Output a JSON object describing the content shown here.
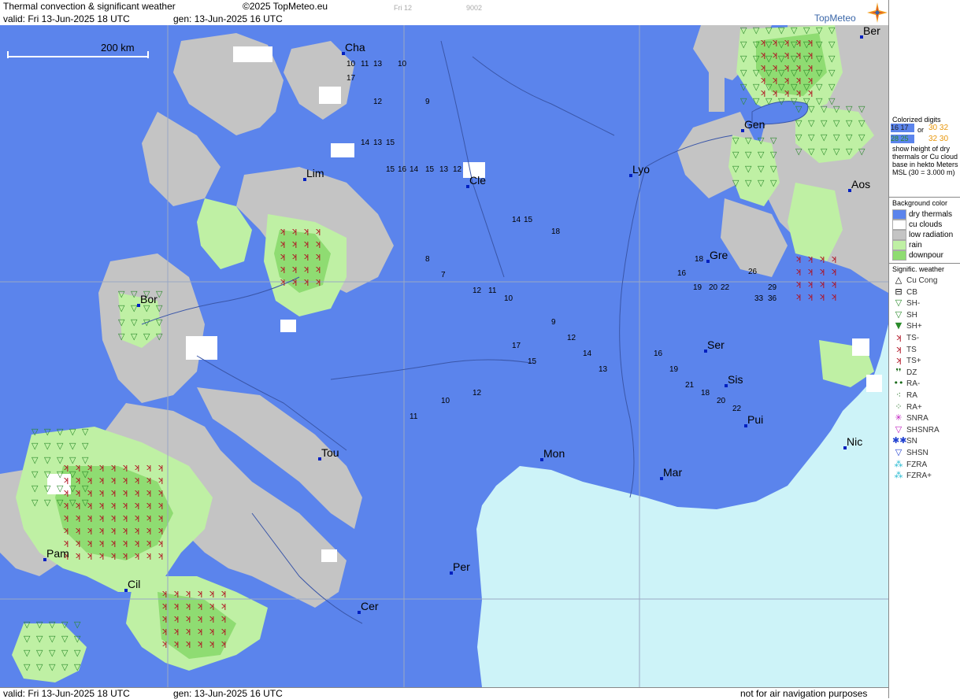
{
  "header": {
    "title": "Thermal convection & significant weather",
    "copyright": "©2025 TopMeteo.eu",
    "valid": "valid:  Fri  13-Jun-2025  18 UTC",
    "generated": "gen: 13-Jun-2025 16 UTC",
    "faint_day": "Fri 12",
    "faint_code": "9002",
    "logo": "TopMeteo"
  },
  "footer": {
    "valid": "valid:  Fri  13-Jun-2025  18 UTC",
    "generated": "gen: 13-Jun-2025 16 UTC",
    "disclaimer": "not for air navigation purposes"
  },
  "map": {
    "scale_label": "200 km",
    "colors": {
      "dry_thermals": "#5b84ec",
      "cu_clouds": "#ffffff",
      "low_radiation": "#c4c4c4",
      "rain": "#bff0a4",
      "downpour": "#8fdc72",
      "sea": "#cdf3f8",
      "grid": "#9aa8c4",
      "river": "#3a56a8",
      "ts_symbol": "#b01020",
      "sh_symbol": "#2a8a2a"
    },
    "cities": [
      {
        "id": "ber",
        "label": "Ber"
      },
      {
        "id": "cha",
        "label": "Cha"
      },
      {
        "id": "gen",
        "label": "Gen"
      },
      {
        "id": "lyo",
        "label": "Lyo"
      },
      {
        "id": "lim",
        "label": "Lim"
      },
      {
        "id": "cle",
        "label": "Cle"
      },
      {
        "id": "aos",
        "label": "Aos"
      },
      {
        "id": "gre",
        "label": "Gre"
      },
      {
        "id": "bor",
        "label": "Bor"
      },
      {
        "id": "ser",
        "label": "Ser"
      },
      {
        "id": "sis",
        "label": "Sis"
      },
      {
        "id": "pui",
        "label": "Pui"
      },
      {
        "id": "tou",
        "label": "Tou"
      },
      {
        "id": "mon",
        "label": "Mon"
      },
      {
        "id": "nic",
        "label": "Nic"
      },
      {
        "id": "mar",
        "label": "Mar"
      },
      {
        "id": "pam",
        "label": "Pam"
      },
      {
        "id": "cil",
        "label": "Cil"
      },
      {
        "id": "per",
        "label": "Per"
      },
      {
        "id": "cer",
        "label": "Cer"
      }
    ],
    "thermal_digits": [
      {
        "id": "d1",
        "v": "10"
      },
      {
        "id": "d2",
        "v": "11"
      },
      {
        "id": "d3",
        "v": "13"
      },
      {
        "id": "d4",
        "v": "10"
      },
      {
        "id": "d5",
        "v": "12"
      },
      {
        "id": "d6",
        "v": "14"
      },
      {
        "id": "d7",
        "v": "13"
      },
      {
        "id": "d8",
        "v": "15"
      },
      {
        "id": "d9",
        "v": "17"
      },
      {
        "id": "d10",
        "v": "15"
      },
      {
        "id": "d11",
        "v": "16"
      },
      {
        "id": "d12",
        "v": "14"
      },
      {
        "id": "d13",
        "v": "15"
      },
      {
        "id": "d14",
        "v": "13"
      },
      {
        "id": "d15",
        "v": "12"
      },
      {
        "id": "d16",
        "v": "9"
      },
      {
        "id": "d17",
        "v": "14"
      },
      {
        "id": "d18",
        "v": "15"
      },
      {
        "id": "d19",
        "v": "18"
      },
      {
        "id": "d20",
        "v": "18"
      },
      {
        "id": "d21",
        "v": "16"
      },
      {
        "id": "d22",
        "v": "19"
      },
      {
        "id": "d23",
        "v": "20"
      },
      {
        "id": "d24",
        "v": "22"
      },
      {
        "id": "d25",
        "v": "26"
      },
      {
        "id": "d26",
        "v": "29"
      },
      {
        "id": "d27",
        "v": "33"
      },
      {
        "id": "d28",
        "v": "36"
      },
      {
        "id": "d29",
        "v": "12"
      },
      {
        "id": "d30",
        "v": "11"
      },
      {
        "id": "d31",
        "v": "10"
      },
      {
        "id": "d32",
        "v": "8"
      },
      {
        "id": "d33",
        "v": "7"
      },
      {
        "id": "d34",
        "v": "9"
      },
      {
        "id": "d35",
        "v": "12"
      },
      {
        "id": "d36",
        "v": "14"
      },
      {
        "id": "d37",
        "v": "13"
      },
      {
        "id": "d38",
        "v": "16"
      },
      {
        "id": "d39",
        "v": "19"
      },
      {
        "id": "d40",
        "v": "21"
      },
      {
        "id": "d41",
        "v": "18"
      },
      {
        "id": "d42",
        "v": "20"
      },
      {
        "id": "d43",
        "v": "22"
      },
      {
        "id": "d44",
        "v": "17"
      },
      {
        "id": "d45",
        "v": "15"
      },
      {
        "id": "d46",
        "v": "12"
      },
      {
        "id": "d47",
        "v": "10"
      },
      {
        "id": "d48",
        "v": "11"
      }
    ]
  },
  "legend": {
    "colorized_title": "Colorized digits",
    "or_label": "or",
    "ex_blue_1": "16 17",
    "ex_blue_2": "28 25",
    "ex_orange_1": "30 32",
    "ex_orange_2": "32 30",
    "explain": "show height of dry thermals or Cu cloud base in hekto Meters MSL (30 = 3.000 m)",
    "bg_title": "Background color",
    "bg_items": [
      {
        "label": "dry thermals",
        "color": "#5b84ec"
      },
      {
        "label": "cu clouds",
        "color": "#ffffff"
      },
      {
        "label": "low radiation",
        "color": "#c4c4c4"
      },
      {
        "label": "rain",
        "color": "#bff0a4"
      },
      {
        "label": "downpour",
        "color": "#8fdc72"
      }
    ],
    "wx_title": "Signific. weather",
    "wx_items": [
      {
        "label": "Cu Cong",
        "icon": "cu-cong-icon",
        "glyph": "△",
        "color": "#000000"
      },
      {
        "label": "CB",
        "icon": "cb-icon",
        "glyph": "⊟",
        "color": "#000000"
      },
      {
        "label": "SH-",
        "icon": "shower-light-icon",
        "glyph": "▽",
        "color": "#2a8a2a"
      },
      {
        "label": "SH",
        "icon": "shower-icon",
        "glyph": "▽",
        "color": "#2a8a2a"
      },
      {
        "label": "SH+",
        "icon": "shower-heavy-icon",
        "glyph": "▼",
        "color": "#2a8a2a"
      },
      {
        "label": "TS-",
        "icon": "thunderstorm-light-icon",
        "glyph": "ʞ",
        "color": "#b01020"
      },
      {
        "label": "TS",
        "icon": "thunderstorm-icon",
        "glyph": "ʞ",
        "color": "#b01020"
      },
      {
        "label": "TS+",
        "icon": "thunderstorm-heavy-icon",
        "glyph": "ʞ",
        "color": "#b01020"
      },
      {
        "label": "DZ",
        "icon": "drizzle-icon",
        "glyph": "❜❜",
        "color": "#1a6a1a"
      },
      {
        "label": "RA-",
        "icon": "rain-light-icon",
        "glyph": "••",
        "color": "#1a6a1a"
      },
      {
        "label": "RA",
        "icon": "rain-icon",
        "glyph": "⁖",
        "color": "#1a6a1a"
      },
      {
        "label": "RA+",
        "icon": "rain-heavy-icon",
        "glyph": "⁘",
        "color": "#1a6a1a"
      },
      {
        "label": "SNRA",
        "icon": "snow-rain-icon",
        "glyph": "✳",
        "color": "#c020c0"
      },
      {
        "label": "SHSNRA",
        "icon": "shower-snow-rain-icon",
        "glyph": "▽",
        "color": "#c020c0"
      },
      {
        "label": "SN",
        "icon": "snow-icon",
        "glyph": "✱✱",
        "color": "#2040d0"
      },
      {
        "label": "SHSN",
        "icon": "shower-snow-icon",
        "glyph": "▽",
        "color": "#2040d0"
      },
      {
        "label": "FZRA",
        "icon": "freezing-rain-icon",
        "glyph": "⁂",
        "color": "#20b8d0"
      },
      {
        "label": "FZRA+",
        "icon": "freezing-rain-heavy-icon",
        "glyph": "⁂",
        "color": "#20b8d0"
      }
    ]
  }
}
